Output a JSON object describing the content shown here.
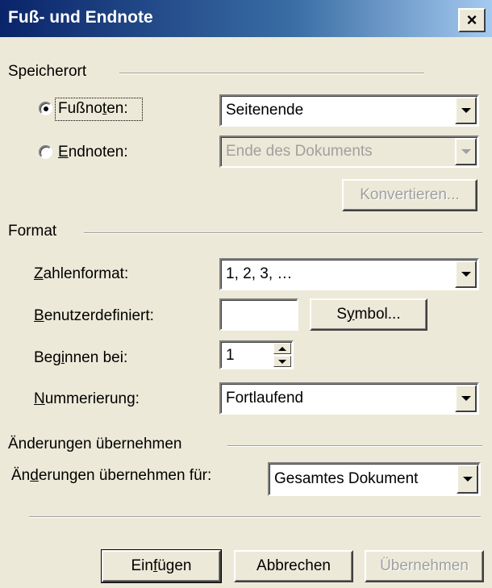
{
  "dialog": {
    "title": "Fuß- und Endnote",
    "close_label": "×"
  },
  "location": {
    "group_label": "Speicherort",
    "footnotes": {
      "pre": "Fußno",
      "key": "t",
      "post": "en:",
      "selected": true,
      "value": "Seitenende"
    },
    "endnotes": {
      "pre": "",
      "key": "E",
      "post": "ndnoten:",
      "selected": false,
      "value": "Ende des Dokuments"
    },
    "convert_label": "Konvertieren..."
  },
  "format": {
    "group_label": "Format",
    "number_format": {
      "key": "Z",
      "post": "ahlenformat:",
      "value": "1, 2, 3, …"
    },
    "custom_mark": {
      "key": "B",
      "post": "enutzerdefiniert:",
      "value": ""
    },
    "symbol_button": {
      "pre": "S",
      "key": "y",
      "post": "mbol..."
    },
    "start_at": {
      "pre": "Beg",
      "key": "i",
      "post": "nnen bei:",
      "value": "1"
    },
    "numbering": {
      "key": "N",
      "post": "ummerierung:",
      "value": "Fortlaufend"
    }
  },
  "apply_changes": {
    "group_label": "Änderungen übernehmen",
    "apply_to": {
      "pre": "Än",
      "key": "d",
      "post": "erungen übernehmen für:",
      "value": "Gesamtes Dokument"
    }
  },
  "buttons": {
    "insert": {
      "pre": "Ein",
      "key": "f",
      "post": "ügen"
    },
    "cancel": "Abbrechen",
    "apply": "Übernehmen"
  }
}
